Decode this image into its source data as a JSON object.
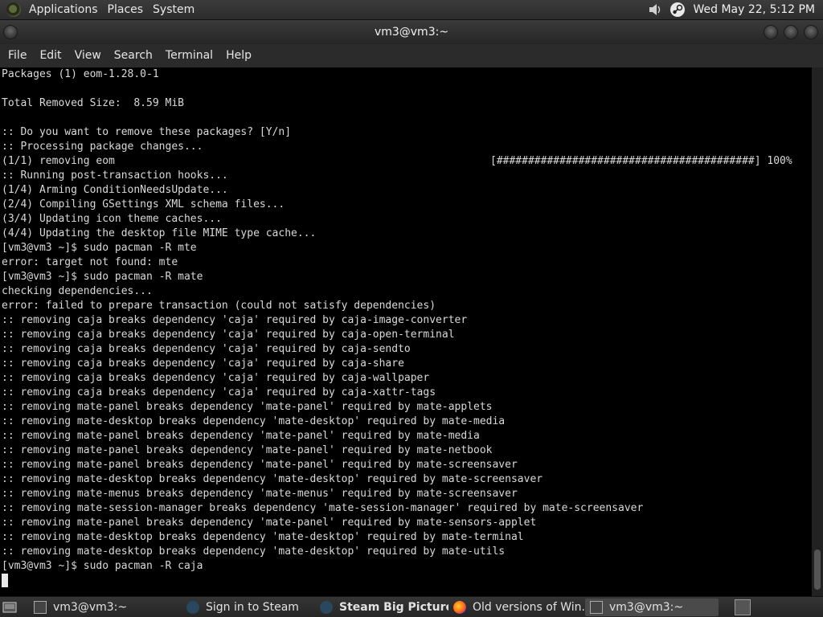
{
  "top_panel": {
    "menus": [
      "Applications",
      "Places",
      "System"
    ],
    "tray_icons": [
      "volume-icon",
      "steam-icon"
    ],
    "clock": "Wed May 22,  5:12 PM"
  },
  "window": {
    "title": "vm3@vm3:~"
  },
  "menubar": {
    "items": [
      "File",
      "Edit",
      "View",
      "Search",
      "Terminal",
      "Help"
    ]
  },
  "terminal": {
    "lines": [
      "Packages (1) eom-1.28.0-1",
      "",
      "Total Removed Size:  8.59 MiB",
      "",
      ":: Do you want to remove these packages? [Y/n]",
      ":: Processing package changes...",
      "(1/1) removing eom",
      ":: Running post-transaction hooks...",
      "(1/4) Arming ConditionNeedsUpdate...",
      "(2/4) Compiling GSettings XML schema files...",
      "(3/4) Updating icon theme caches...",
      "(4/4) Updating the desktop file MIME type cache...",
      "[vm3@vm3 ~]$ sudo pacman -R mte",
      "error: target not found: mte",
      "[vm3@vm3 ~]$ sudo pacman -R mate",
      "checking dependencies...",
      "error: failed to prepare transaction (could not satisfy dependencies)",
      ":: removing caja breaks dependency 'caja' required by caja-image-converter",
      ":: removing caja breaks dependency 'caja' required by caja-open-terminal",
      ":: removing caja breaks dependency 'caja' required by caja-sendto",
      ":: removing caja breaks dependency 'caja' required by caja-share",
      ":: removing caja breaks dependency 'caja' required by caja-wallpaper",
      ":: removing caja breaks dependency 'caja' required by caja-xattr-tags",
      ":: removing mate-panel breaks dependency 'mate-panel' required by mate-applets",
      ":: removing mate-desktop breaks dependency 'mate-desktop' required by mate-media",
      ":: removing mate-panel breaks dependency 'mate-panel' required by mate-media",
      ":: removing mate-panel breaks dependency 'mate-panel' required by mate-netbook",
      ":: removing mate-panel breaks dependency 'mate-panel' required by mate-screensaver",
      ":: removing mate-desktop breaks dependency 'mate-desktop' required by mate-screensaver",
      ":: removing mate-menus breaks dependency 'mate-menus' required by mate-screensaver",
      ":: removing mate-session-manager breaks dependency 'mate-session-manager' required by mate-screensaver",
      ":: removing mate-panel breaks dependency 'mate-panel' required by mate-sensors-applet",
      ":: removing mate-desktop breaks dependency 'mate-desktop' required by mate-terminal",
      ":: removing mate-desktop breaks dependency 'mate-desktop' required by mate-utils",
      "[vm3@vm3 ~]$ sudo pacman -R caja"
    ],
    "progress_text": "[#########################################] 100%"
  },
  "taskbar": {
    "tasks": [
      {
        "label": "vm3@vm3:~",
        "icon": "terminal-icon"
      },
      {
        "label": "Sign in to Steam",
        "icon": "steam-icon"
      },
      {
        "label": "Steam Big Picture ...",
        "icon": "steam-icon"
      },
      {
        "label": "Old versions of Win...",
        "icon": "firefox-icon"
      },
      {
        "label": "vm3@vm3:~",
        "icon": "terminal-icon"
      }
    ]
  }
}
